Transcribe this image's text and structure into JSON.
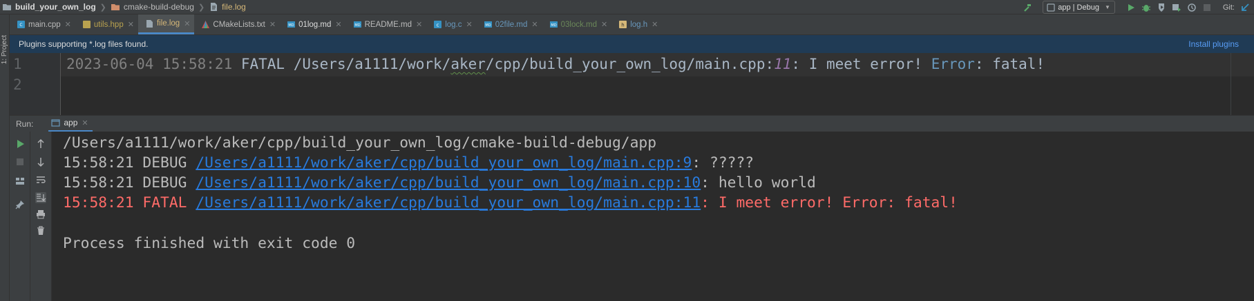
{
  "navbar": {
    "project": "build_your_own_log",
    "folder": "cmake-build-debug",
    "file": "file.log",
    "run_config": "app | Debug",
    "git_label": "Git:"
  },
  "left_strip": {
    "project_label": "1: Project"
  },
  "tabs": [
    {
      "label": "main.cpp",
      "icon": "cpp-file-icon",
      "color": "#bbbbbb"
    },
    {
      "label": "utils.hpp",
      "icon": "hpp-file-icon",
      "color": "#b9a24f"
    },
    {
      "label": "file.log",
      "icon": "log-file-icon",
      "color": "#d5b778",
      "active": true
    },
    {
      "label": "CMakeLists.txt",
      "icon": "cmake-icon",
      "color": "#bbbbbb"
    },
    {
      "label": "01log.md",
      "icon": "md-file-icon",
      "color": "#dcdcdc"
    },
    {
      "label": "README.md",
      "icon": "md-file-icon",
      "color": "#bbbbbb"
    },
    {
      "label": "log.c",
      "icon": "c-file-icon",
      "color": "#6897bb"
    },
    {
      "label": "02file.md",
      "icon": "md-file-icon",
      "color": "#6897bb"
    },
    {
      "label": "03lock.md",
      "icon": "md-file-icon",
      "color": "#6a8759"
    },
    {
      "label": "log.h",
      "icon": "h-file-icon",
      "color": "#6897bb"
    }
  ],
  "banner": {
    "text": "Plugins supporting *.log files found.",
    "action": "Install plugins"
  },
  "editor": {
    "line_numbers": [
      "1",
      "2"
    ],
    "line1": {
      "timestamp": "2023-06-04 15:58:21",
      "level": " FATAL ",
      "path_a": "/Users/a1111/work/",
      "path_b": "aker",
      "path_c": "/cpp/build_your_own_log/main.cpp:",
      "line_no": "11",
      "msg": ": I meet error! ",
      "error_kw": "Error",
      "msg_end": ": fatal!"
    }
  },
  "run": {
    "label": "Run:",
    "tab": "app",
    "lines": [
      {
        "text": "/Users/a1111/work/aker/cpp/build_your_own_log/cmake-build-debug/app"
      },
      {
        "prefix": "15:58:21 DEBUG ",
        "link": "/Users/a1111/work/aker/cpp/build_your_own_log/main.cpp:9",
        "suffix": ": ?????"
      },
      {
        "prefix": "15:58:21 DEBUG ",
        "link": "/Users/a1111/work/aker/cpp/build_your_own_log/main.cpp:10",
        "suffix": ": hello world"
      },
      {
        "prefix": "15:58:21 FATAL ",
        "link": "/Users/a1111/work/aker/cpp/build_your_own_log/main.cpp:11",
        "suffix": ": I meet error! Error: fatal!"
      },
      {
        "text": "Process finished with exit code 0"
      }
    ]
  },
  "colors": {
    "accent": "#4a88c7",
    "link": "#287bde",
    "fatal": "#ff6b68",
    "banner_bg": "#203b55"
  }
}
